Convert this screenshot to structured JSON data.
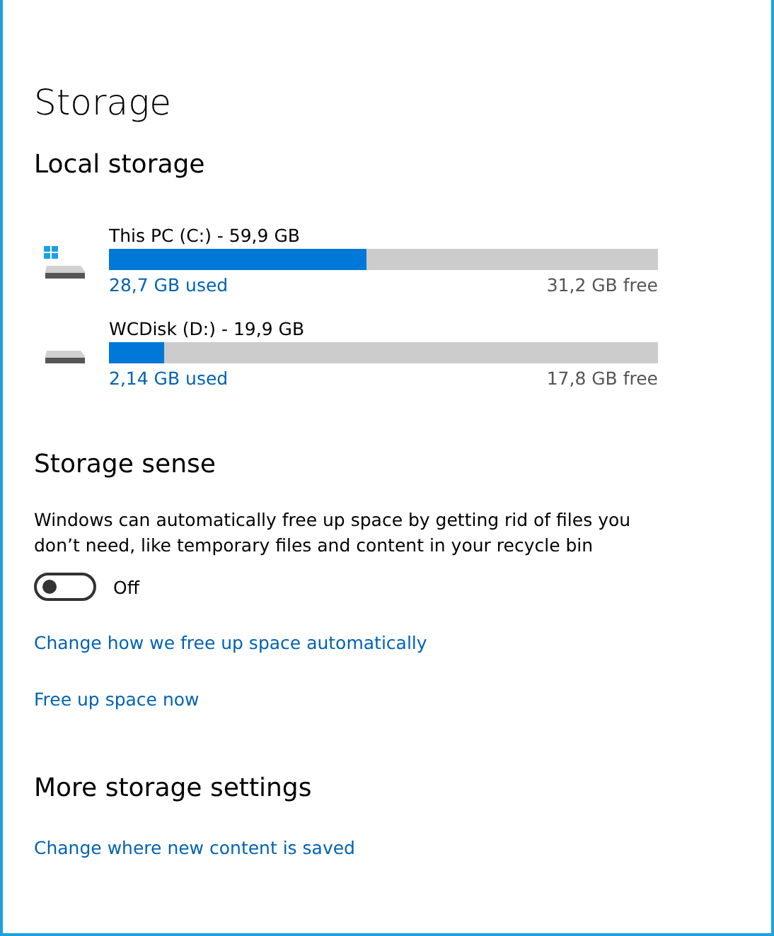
{
  "title": "Storage",
  "local_storage": {
    "heading": "Local storage",
    "drives": [
      {
        "kind": "system",
        "name": "This PC (C:) - 59,9 GB",
        "level": 0.47,
        "used": "28,7 GB used",
        "free": "31,2 GB free"
      },
      {
        "kind": "disk",
        "name": "WCDisk (D:) - 19,9 GB",
        "level": 0.1,
        "used": "2,14 GB used",
        "free": "17,8 GB free"
      }
    ]
  },
  "storage_sense": {
    "heading": "Storage sense",
    "description": "Windows can automatically free up space by getting rid of files you don’t need, like temporary files and content in your recycle bin",
    "toggle": {
      "on": false,
      "label": "Off"
    },
    "links": [
      "Change how we free up space automatically",
      "Free up space now"
    ]
  },
  "more_settings": {
    "heading": "More storage settings",
    "links": [
      "Change where new content is saved"
    ]
  }
}
